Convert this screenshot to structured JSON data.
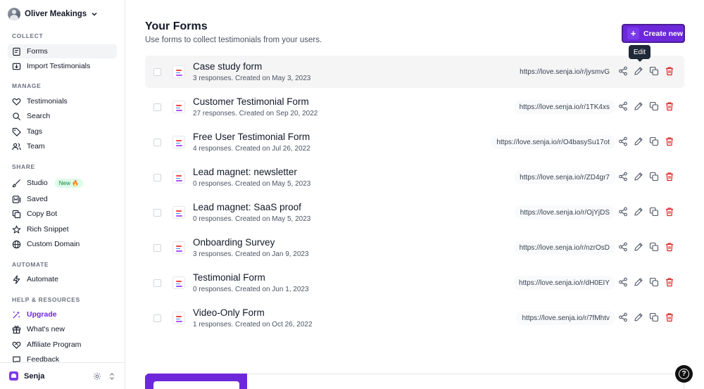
{
  "user": {
    "name": "Oliver Meakings"
  },
  "sidebar": {
    "sections": {
      "collect": "COLLECT",
      "manage": "MANAGE",
      "share": "SHARE",
      "automate": "AUTOMATE",
      "help": "HELP & RESOURCES"
    },
    "items": [
      {
        "label": "Forms",
        "icon": "forms-icon"
      },
      {
        "label": "Import Testimonials",
        "icon": "import-icon"
      },
      {
        "label": "Testimonials",
        "icon": "heart-icon"
      },
      {
        "label": "Search",
        "icon": "search-icon"
      },
      {
        "label": "Tags",
        "icon": "tag-icon"
      },
      {
        "label": "Team",
        "icon": "team-icon"
      },
      {
        "label": "Studio",
        "icon": "brush-icon",
        "badge": "New 🔥"
      },
      {
        "label": "Saved",
        "icon": "bookmark-icon"
      },
      {
        "label": "Copy Bot",
        "icon": "copy-icon"
      },
      {
        "label": "Rich Snippet",
        "icon": "star-icon"
      },
      {
        "label": "Custom Domain",
        "icon": "globe-icon"
      },
      {
        "label": "Automate",
        "icon": "bolt-icon"
      },
      {
        "label": "Upgrade",
        "icon": "sparkle-icon"
      },
      {
        "label": "What's new",
        "icon": "gift-icon"
      },
      {
        "label": "Affiliate Program",
        "icon": "handshake-icon"
      },
      {
        "label": "Feedback",
        "icon": "feedback-icon"
      }
    ]
  },
  "footer": {
    "brand": "Senja"
  },
  "header": {
    "title": "Your Forms",
    "subtitle": "Use forms to collect testimonials from your users.",
    "create_label": "Create new"
  },
  "tooltip": "Edit",
  "forms": [
    {
      "name": "Case study form",
      "meta": "3 responses. Created on May 3, 2023",
      "url": "https://love.senja.io/r/jysmvG"
    },
    {
      "name": "Customer Testimonial Form",
      "meta": "27 responses. Created on Sep 20, 2022",
      "url": "https://love.senja.io/r/1TK4xs"
    },
    {
      "name": "Free User Testimonial Form",
      "meta": "4 responses. Created on Jul 26, 2022",
      "url": "https://love.senja.io/r/O4basySu17ot"
    },
    {
      "name": "Lead magnet: newsletter",
      "meta": "0 responses. Created on May 5, 2023",
      "url": "https://love.senja.io/r/ZD4gr7"
    },
    {
      "name": "Lead magnet: SaaS proof",
      "meta": "0 responses. Created on May 5, 2023",
      "url": "https://love.senja.io/r/OjYjDS"
    },
    {
      "name": "Onboarding Survey",
      "meta": "3 responses. Created on Jan 9, 2023",
      "url": "https://love.senja.io/r/nzrOsD"
    },
    {
      "name": "Testimonial Form",
      "meta": "0 responses. Created on Jun 1, 2023",
      "url": "https://love.senja.io/r/dH0EIY"
    },
    {
      "name": "Video-Only Form",
      "meta": "1 responses. Created on Oct 26, 2022",
      "url": "https://love.senja.io/r/7fMhtv"
    }
  ],
  "colors": {
    "accent": "#6d28d9",
    "delete": "#dc2626"
  }
}
